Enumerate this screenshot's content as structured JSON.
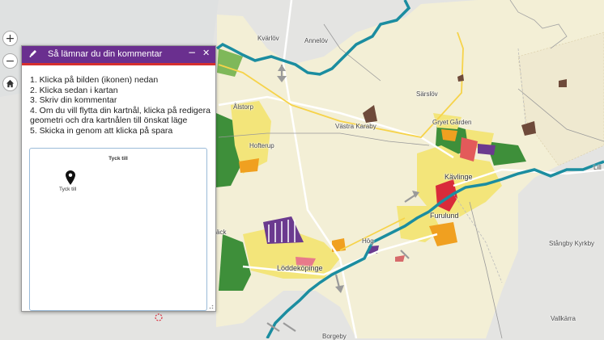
{
  "panel": {
    "title": "Så lämnar du din kommentar",
    "instructions": [
      "1. Klicka på bilden (ikonen) nedan",
      "2. Klicka sedan i kartan",
      "3. Skriv din kommentar",
      "4. Om du vill flytta din kartnål, klicka på redigera geometri och dra kartnålen till önskat läge",
      "5. Skicka in genom att klicka på spara"
    ],
    "card_title": "Tyck till",
    "pin_label": "Tyck till"
  },
  "map_controls": {
    "zoom_in": "+",
    "zoom_out": "−"
  },
  "place_labels": {
    "kvarlov": "Kvärlöv",
    "annelov": "Annelöv",
    "sarslov": "Särslöv",
    "alstorp": "Ålstorp",
    "hofterup": "Hofterup",
    "vastra_karaby": "Västra Karaby",
    "gryet_garden": "Gryet Gården",
    "kavlinge": "Kävlinge",
    "furulund": "Furulund",
    "hog": "Hög",
    "loddekopinge": "Löddeköpinge",
    "stangby_kyrkby": "Stångby Kyrkby",
    "vallkarra": "Vallkärra",
    "borgeby": "Borgeby",
    "lilla": "Lill",
    "ack": "äck"
  },
  "colors": {
    "header": "#6a2f8f",
    "header_stripe": "#d62f2f",
    "land": "#f3efd6",
    "water": "#5aa9b4",
    "river": "#1b8da0",
    "forest": "#3e8f3a",
    "residential": "#f3e57a",
    "industry": "#f0a020",
    "center": "#d92b3a",
    "purple_zone": "#6b3a8f"
  }
}
